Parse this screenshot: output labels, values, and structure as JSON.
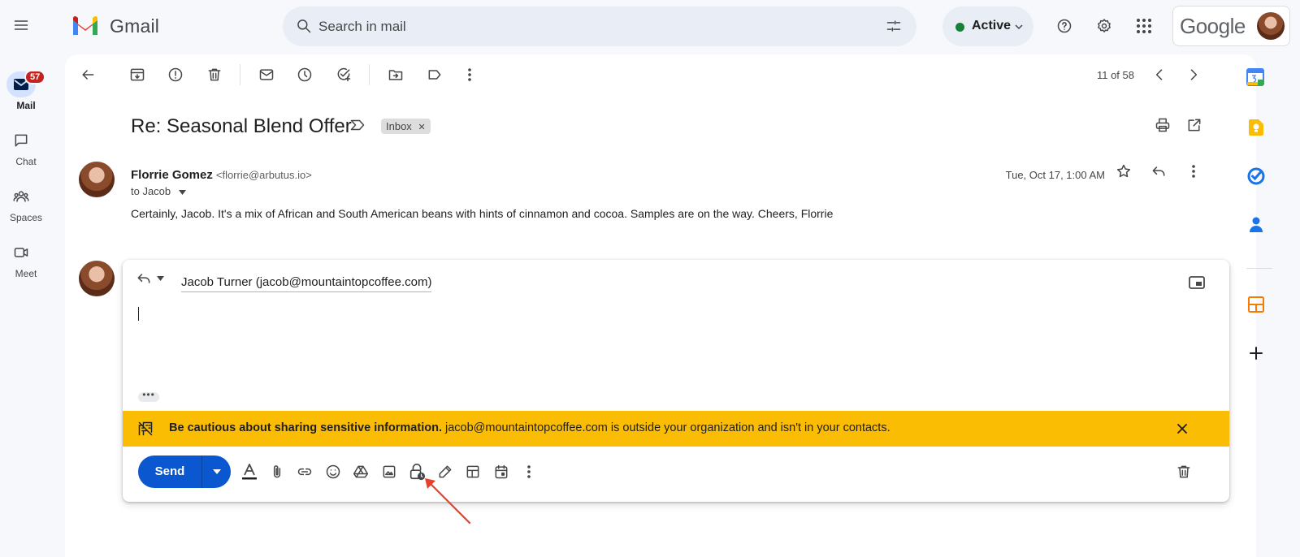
{
  "app": {
    "name": "Gmail"
  },
  "search": {
    "placeholder": "Search in mail"
  },
  "status": {
    "label": "Active",
    "color": "#188038"
  },
  "account": {
    "brand": "Google"
  },
  "rail": {
    "mail_label": "Mail",
    "mail_badge": "57",
    "chat_label": "Chat",
    "spaces_label": "Spaces",
    "meet_label": "Meet"
  },
  "toolbar": {
    "count": "11 of 58"
  },
  "thread": {
    "subject": "Re: Seasonal Blend Offer",
    "label_chip": "Inbox",
    "sender_name": "Florrie Gomez",
    "sender_email": "<florrie@arbutus.io>",
    "to_line": "to Jacob",
    "timestamp": "Tue, Oct 17, 1:00 AM",
    "body": "Certainly, Jacob. It's a mix of African and South American beans with hints of cinnamon and cocoa. Samples are on the way. Cheers, Florrie"
  },
  "compose": {
    "recipient": "Jacob Turner (jacob@mountaintopcoffee.com)",
    "warning_bold": "Be cautious about sharing sensitive information.",
    "warning_rest": " jacob@mountaintopcoffee.com is outside your organization and isn't in your contacts.",
    "send_label": "Send",
    "warning_color": "#fbbc04",
    "send_color": "#0b57d0"
  },
  "annotation": {
    "type": "red-arrow",
    "points_to": "confidential-mode-icon",
    "color": "#e8402c"
  }
}
